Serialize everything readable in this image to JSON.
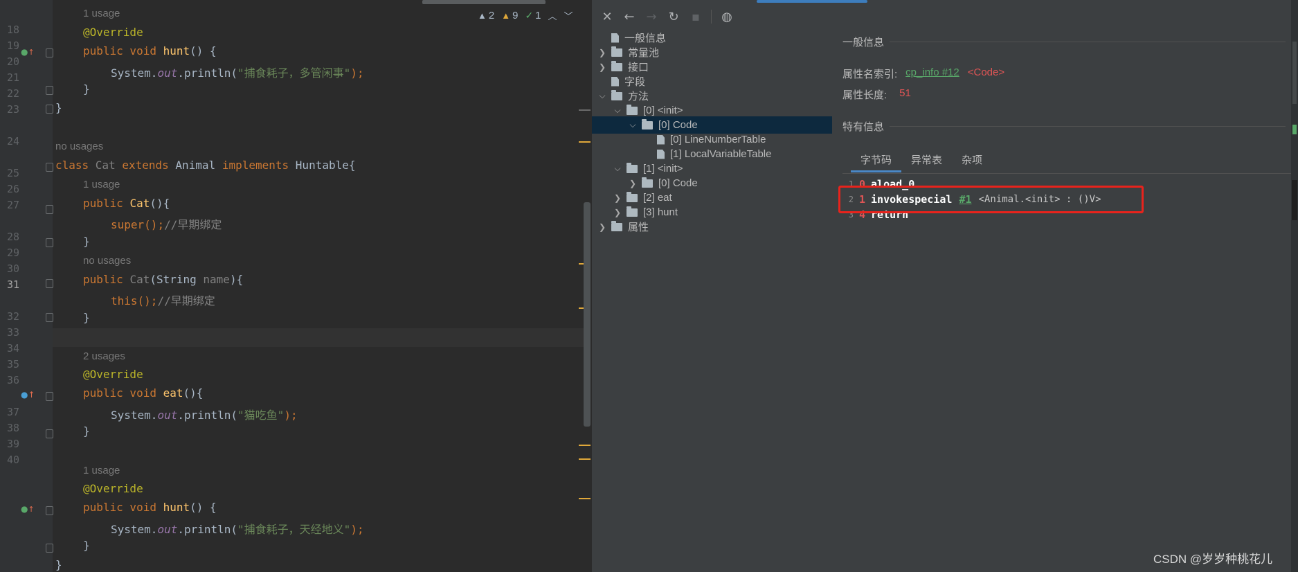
{
  "editor": {
    "inspections": {
      "warnings": "2",
      "weak_warnings": "9",
      "ok": "1"
    },
    "line_numbers": [
      "18",
      "19",
      "20",
      "21",
      "22",
      "23",
      "24",
      "25",
      "26",
      "27",
      "28",
      "29",
      "30",
      "31",
      "32",
      "33",
      "34",
      "35",
      "36",
      "37",
      "38",
      "39",
      "40"
    ],
    "hints": {
      "h1": "1 usage",
      "h2": "no usages",
      "h3": "1 usage",
      "h4": "no usages",
      "h5": "2 usages",
      "h6": "1 usage"
    },
    "code": {
      "l18_ann": "@Override",
      "l19_kw": "public void ",
      "l19_fn": "hunt",
      "l19_rest": "() {",
      "l20_pre": "System.",
      "l20_fld": "out",
      "l20_mid": ".println(",
      "l20_str": "\"捕食耗子，多管闲事\"",
      "l20_end": ");",
      "l21": "}",
      "l22": "}",
      "l24_kw1": "class ",
      "l24_cls": "Cat ",
      "l24_kw2": "extends ",
      "l24_p1": "Animal ",
      "l24_kw3": "implements ",
      "l24_p2": "Huntable{",
      "l25_kw": "public ",
      "l25_fn": "Cat",
      "l25_rest": "(){",
      "l26_kw": "super",
      "l26_rest": "();",
      "l26_cmt": "//早期绑定",
      "l27": "}",
      "l28_kw": "public ",
      "l28_name": "Cat",
      "l28_p1": "(String ",
      "l28_param": "name",
      "l28_p2": "){",
      "l29_kw": "this",
      "l29_rest": "();",
      "l29_cmt": "//早期绑定",
      "l30": "}",
      "l32_ann": "@Override",
      "l33_kw": "public void ",
      "l33_fn": "eat",
      "l33_rest": "(){",
      "l34_pre": "System.",
      "l34_fld": "out",
      "l34_mid": ".println(",
      "l34_str": "\"猫吃鱼\"",
      "l34_end": ");",
      "l35": "}",
      "l37_ann": "@Override",
      "l38_kw": "public void ",
      "l38_fn": "hunt",
      "l38_rest": "() {",
      "l39_pre": "System.",
      "l39_fld": "out",
      "l39_mid": ".println(",
      "l39_str": "\"捕食耗子，天经地义\"",
      "l39_end": ");",
      "l40": "}",
      "l41": "}"
    }
  },
  "viewer": {
    "tree": [
      {
        "label": "一般信息"
      },
      {
        "label": "常量池"
      },
      {
        "label": "接口"
      },
      {
        "label": "字段"
      },
      {
        "label": "方法"
      },
      {
        "label": "[0] <init>"
      },
      {
        "label": "[0] Code"
      },
      {
        "label": "[0] LineNumberTable"
      },
      {
        "label": "[1] LocalVariableTable"
      },
      {
        "label": "[1] <init>"
      },
      {
        "label": "[0] Code"
      },
      {
        "label": "[2] eat"
      },
      {
        "label": "[3] hunt"
      },
      {
        "label": "属性"
      }
    ],
    "general_title": "一般信息",
    "attr_name_label": "属性名索引:",
    "attr_name_link": "cp_info #12",
    "attr_name_value": "<Code>",
    "attr_len_label": "属性长度:",
    "attr_len_value": "51",
    "specific_title": "特有信息",
    "tabs": [
      "字节码",
      "异常表",
      "杂项"
    ],
    "bytecode": [
      {
        "ln": "1",
        "off": "0",
        "op": "aload_0",
        "ref": "",
        "desc": ""
      },
      {
        "ln": "2",
        "off": "1",
        "op": "invokespecial",
        "ref": "#1",
        "desc": "<Animal.<init> : ()V>"
      },
      {
        "ln": "3",
        "off": "4",
        "op": "return",
        "ref": "",
        "desc": ""
      }
    ]
  },
  "watermark": "CSDN @岁岁种桃花儿",
  "colors": {
    "editor_bg": "#2b2b2b",
    "keyword": "#cc7832",
    "annotation": "#bbb529",
    "method": "#ffc66d",
    "string": "#6a8759",
    "viewer_bg": "#3c3f41",
    "selection": "#0d293e",
    "highlight_box": "#e8231c"
  }
}
